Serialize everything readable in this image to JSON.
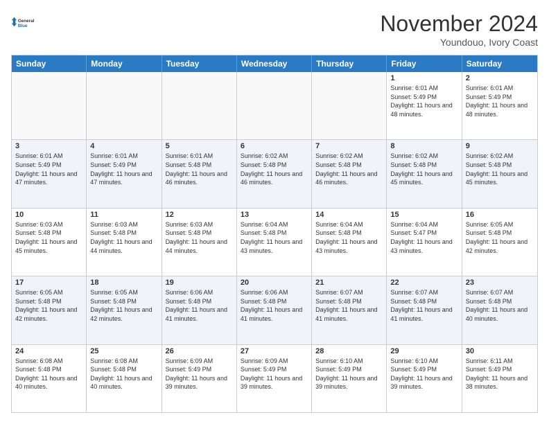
{
  "logo": {
    "line1": "General",
    "line2": "Blue"
  },
  "title": "November 2024",
  "subtitle": "Youndouo, Ivory Coast",
  "header_days": [
    "Sunday",
    "Monday",
    "Tuesday",
    "Wednesday",
    "Thursday",
    "Friday",
    "Saturday"
  ],
  "rows": [
    [
      {
        "day": "",
        "info": "",
        "empty": true
      },
      {
        "day": "",
        "info": "",
        "empty": true
      },
      {
        "day": "",
        "info": "",
        "empty": true
      },
      {
        "day": "",
        "info": "",
        "empty": true
      },
      {
        "day": "",
        "info": "",
        "empty": true
      },
      {
        "day": "1",
        "info": "Sunrise: 6:01 AM\nSunset: 5:49 PM\nDaylight: 11 hours and 48 minutes."
      },
      {
        "day": "2",
        "info": "Sunrise: 6:01 AM\nSunset: 5:49 PM\nDaylight: 11 hours and 48 minutes."
      }
    ],
    [
      {
        "day": "3",
        "info": "Sunrise: 6:01 AM\nSunset: 5:49 PM\nDaylight: 11 hours and 47 minutes.",
        "alt": true
      },
      {
        "day": "4",
        "info": "Sunrise: 6:01 AM\nSunset: 5:49 PM\nDaylight: 11 hours and 47 minutes.",
        "alt": true
      },
      {
        "day": "5",
        "info": "Sunrise: 6:01 AM\nSunset: 5:48 PM\nDaylight: 11 hours and 46 minutes.",
        "alt": true
      },
      {
        "day": "6",
        "info": "Sunrise: 6:02 AM\nSunset: 5:48 PM\nDaylight: 11 hours and 46 minutes.",
        "alt": true
      },
      {
        "day": "7",
        "info": "Sunrise: 6:02 AM\nSunset: 5:48 PM\nDaylight: 11 hours and 46 minutes.",
        "alt": true
      },
      {
        "day": "8",
        "info": "Sunrise: 6:02 AM\nSunset: 5:48 PM\nDaylight: 11 hours and 45 minutes.",
        "alt": true
      },
      {
        "day": "9",
        "info": "Sunrise: 6:02 AM\nSunset: 5:48 PM\nDaylight: 11 hours and 45 minutes.",
        "alt": true
      }
    ],
    [
      {
        "day": "10",
        "info": "Sunrise: 6:03 AM\nSunset: 5:48 PM\nDaylight: 11 hours and 45 minutes."
      },
      {
        "day": "11",
        "info": "Sunrise: 6:03 AM\nSunset: 5:48 PM\nDaylight: 11 hours and 44 minutes."
      },
      {
        "day": "12",
        "info": "Sunrise: 6:03 AM\nSunset: 5:48 PM\nDaylight: 11 hours and 44 minutes."
      },
      {
        "day": "13",
        "info": "Sunrise: 6:04 AM\nSunset: 5:48 PM\nDaylight: 11 hours and 43 minutes."
      },
      {
        "day": "14",
        "info": "Sunrise: 6:04 AM\nSunset: 5:48 PM\nDaylight: 11 hours and 43 minutes."
      },
      {
        "day": "15",
        "info": "Sunrise: 6:04 AM\nSunset: 5:47 PM\nDaylight: 11 hours and 43 minutes."
      },
      {
        "day": "16",
        "info": "Sunrise: 6:05 AM\nSunset: 5:48 PM\nDaylight: 11 hours and 42 minutes."
      }
    ],
    [
      {
        "day": "17",
        "info": "Sunrise: 6:05 AM\nSunset: 5:48 PM\nDaylight: 11 hours and 42 minutes.",
        "alt": true
      },
      {
        "day": "18",
        "info": "Sunrise: 6:05 AM\nSunset: 5:48 PM\nDaylight: 11 hours and 42 minutes.",
        "alt": true
      },
      {
        "day": "19",
        "info": "Sunrise: 6:06 AM\nSunset: 5:48 PM\nDaylight: 11 hours and 41 minutes.",
        "alt": true
      },
      {
        "day": "20",
        "info": "Sunrise: 6:06 AM\nSunset: 5:48 PM\nDaylight: 11 hours and 41 minutes.",
        "alt": true
      },
      {
        "day": "21",
        "info": "Sunrise: 6:07 AM\nSunset: 5:48 PM\nDaylight: 11 hours and 41 minutes.",
        "alt": true
      },
      {
        "day": "22",
        "info": "Sunrise: 6:07 AM\nSunset: 5:48 PM\nDaylight: 11 hours and 41 minutes.",
        "alt": true
      },
      {
        "day": "23",
        "info": "Sunrise: 6:07 AM\nSunset: 5:48 PM\nDaylight: 11 hours and 40 minutes.",
        "alt": true
      }
    ],
    [
      {
        "day": "24",
        "info": "Sunrise: 6:08 AM\nSunset: 5:48 PM\nDaylight: 11 hours and 40 minutes."
      },
      {
        "day": "25",
        "info": "Sunrise: 6:08 AM\nSunset: 5:48 PM\nDaylight: 11 hours and 40 minutes."
      },
      {
        "day": "26",
        "info": "Sunrise: 6:09 AM\nSunset: 5:49 PM\nDaylight: 11 hours and 39 minutes."
      },
      {
        "day": "27",
        "info": "Sunrise: 6:09 AM\nSunset: 5:49 PM\nDaylight: 11 hours and 39 minutes."
      },
      {
        "day": "28",
        "info": "Sunrise: 6:10 AM\nSunset: 5:49 PM\nDaylight: 11 hours and 39 minutes."
      },
      {
        "day": "29",
        "info": "Sunrise: 6:10 AM\nSunset: 5:49 PM\nDaylight: 11 hours and 39 minutes."
      },
      {
        "day": "30",
        "info": "Sunrise: 6:11 AM\nSunset: 5:49 PM\nDaylight: 11 hours and 38 minutes."
      }
    ]
  ]
}
